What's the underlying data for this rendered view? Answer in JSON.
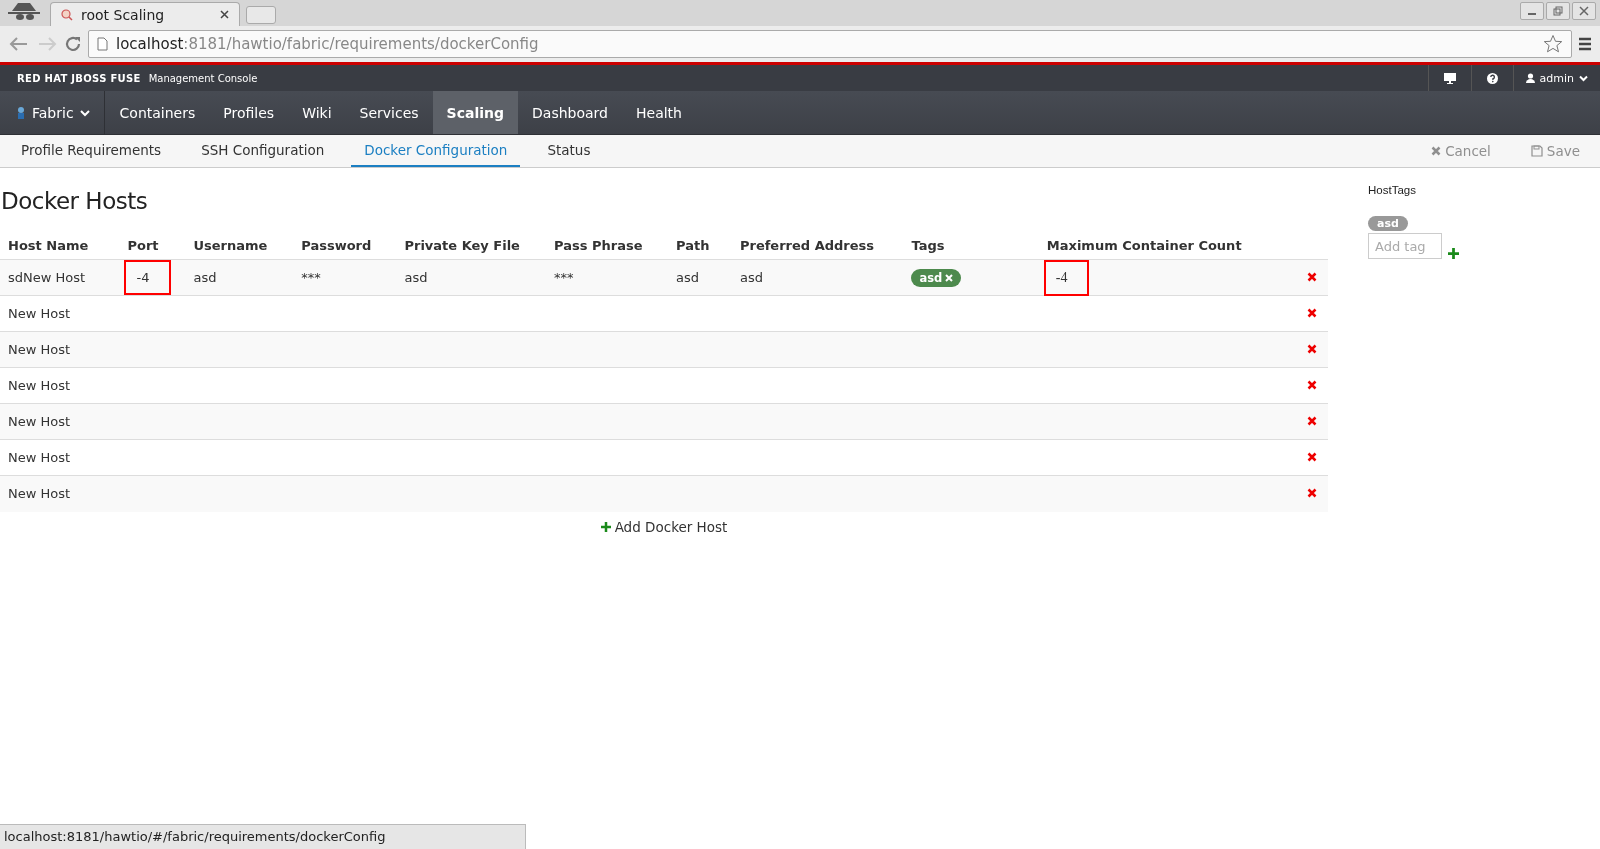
{
  "browser": {
    "tab_title": "root Scaling",
    "url_host": "localhost",
    "url_path": ":8181/hawtio/fabric/requirements/dockerConfig"
  },
  "header": {
    "brand": "RED HAT JBOSS FUSE",
    "subtitle": "Management Console",
    "user": "admin"
  },
  "nav": [
    {
      "label": "Fabric",
      "selected": false,
      "kind": "dropdown"
    },
    {
      "label": "Containers",
      "selected": false,
      "kind": "link"
    },
    {
      "label": "Profiles",
      "selected": false,
      "kind": "link"
    },
    {
      "label": "Wiki",
      "selected": false,
      "kind": "link"
    },
    {
      "label": "Services",
      "selected": false,
      "kind": "link"
    },
    {
      "label": "Scaling",
      "selected": true,
      "kind": "link"
    },
    {
      "label": "Dashboard",
      "selected": false,
      "kind": "link"
    },
    {
      "label": "Health",
      "selected": false,
      "kind": "link"
    }
  ],
  "subnav": [
    {
      "label": "Profile Requirements",
      "selected": false
    },
    {
      "label": "SSH Configuration",
      "selected": false
    },
    {
      "label": "Docker Configuration",
      "selected": true
    },
    {
      "label": "Status",
      "selected": false
    }
  ],
  "actions": [
    {
      "label": "Cancel",
      "kind": "cancel",
      "disabled": true
    },
    {
      "label": "Save",
      "kind": "save",
      "disabled": true
    }
  ],
  "page_title": "Docker Hosts",
  "table": {
    "columns": [
      "Host Name",
      "Port",
      "Username",
      "Password",
      "Private Key File",
      "Pass Phrase",
      "Path",
      "Preferred Address",
      "Tags",
      "Maximum Container Count"
    ],
    "rows": [
      {
        "cells": [
          {
            "text": "sdNew Host",
            "highlighted": false
          },
          {
            "text": "-4",
            "highlighted": true
          },
          {
            "text": "asd",
            "highlighted": false
          },
          {
            "text": "***",
            "highlighted": false
          },
          {
            "text": "asd",
            "highlighted": false
          },
          {
            "text": "***",
            "highlighted": false
          },
          {
            "text": "asd",
            "highlighted": false
          },
          {
            "text": "asd",
            "highlighted": false
          },
          {
            "tags": [
              "asd"
            ],
            "highlighted": false
          },
          {
            "text": "-4",
            "highlighted": true
          }
        ]
      },
      {
        "cells": [
          {
            "text": "New Host",
            "highlighted": false
          }
        ]
      },
      {
        "cells": [
          {
            "text": "New Host",
            "highlighted": false
          }
        ]
      },
      {
        "cells": [
          {
            "text": "New Host",
            "highlighted": false
          }
        ]
      },
      {
        "cells": [
          {
            "text": "New Host",
            "highlighted": false
          }
        ]
      },
      {
        "cells": [
          {
            "text": "New Host",
            "highlighted": false
          }
        ]
      },
      {
        "cells": [
          {
            "text": "New Host",
            "highlighted": false
          }
        ]
      }
    ]
  },
  "add_button": "Add Docker Host",
  "host_tags": {
    "title": "HostTags",
    "tags": [
      "asd"
    ],
    "placeholder": "Add tag"
  },
  "status_bar": "localhost:8181/hawtio/#/fabric/requirements/dockerConfig"
}
